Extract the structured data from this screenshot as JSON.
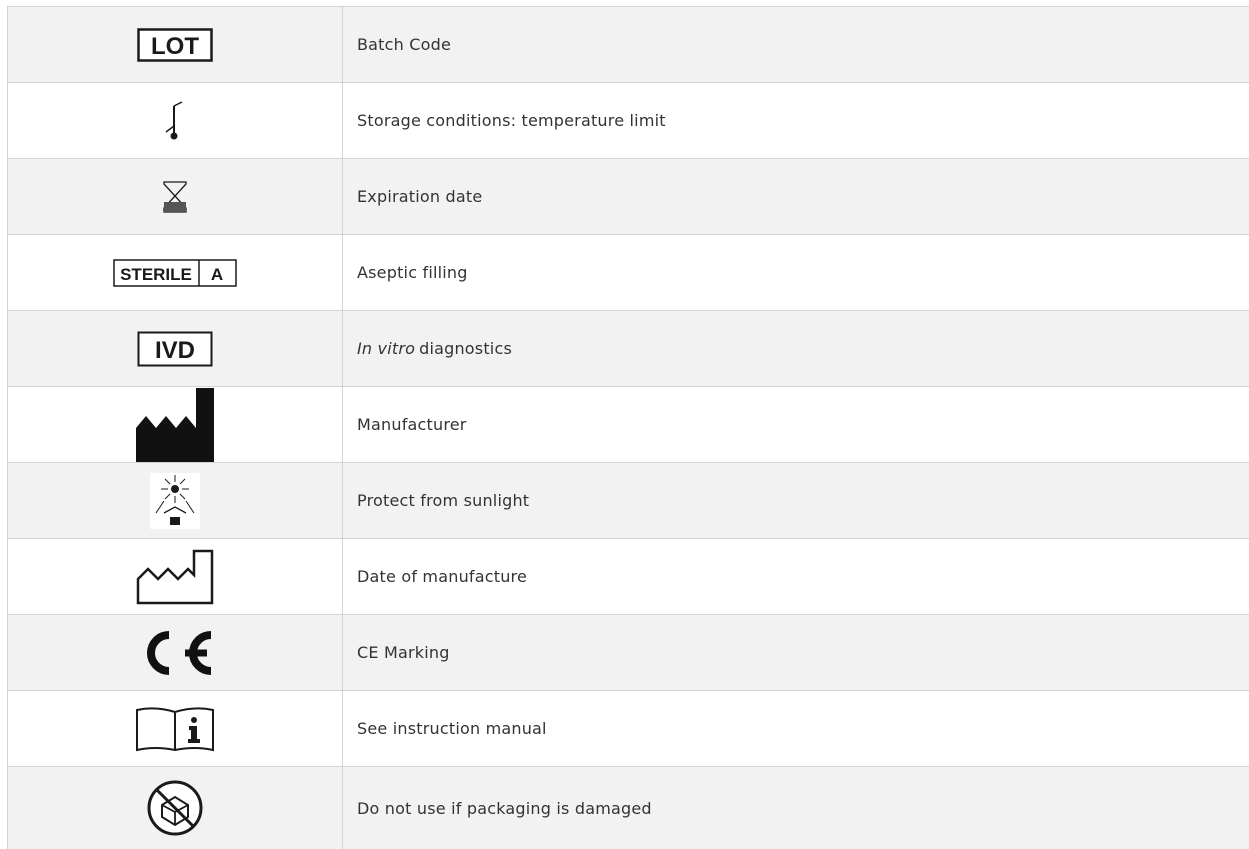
{
  "rows": [
    {
      "icon": "lot-batch-code-icon",
      "icon_text": "LOT",
      "label": "Batch Code"
    },
    {
      "icon": "temperature-limit-icon",
      "label": "Storage conditions: temperature limit"
    },
    {
      "icon": "hourglass-expiration-icon",
      "label": "Expiration date"
    },
    {
      "icon": "sterile-aseptic-icon",
      "icon_text": [
        "STERILE",
        "A"
      ],
      "label": "Aseptic filling"
    },
    {
      "icon": "ivd-icon",
      "icon_text": "IVD",
      "label_italic": "In vitro",
      "label": "diagnostics"
    },
    {
      "icon": "manufacturer-factory-icon",
      "label": "Manufacturer"
    },
    {
      "icon": "protect-from-sunlight-icon",
      "label": "Protect from sunlight"
    },
    {
      "icon": "date-of-manufacture-icon",
      "label": "Date of manufacture"
    },
    {
      "icon": "ce-marking-icon",
      "label": "CE Marking"
    },
    {
      "icon": "instruction-manual-icon",
      "label": "See instruction manual"
    },
    {
      "icon": "do-not-use-damaged-package-icon",
      "label": "Do not use if packaging is damaged"
    }
  ],
  "colors": {
    "border": "#d3d3d3",
    "stripe": "#f2f2f2",
    "text": "#333333",
    "icon": "#1a1a1a"
  }
}
